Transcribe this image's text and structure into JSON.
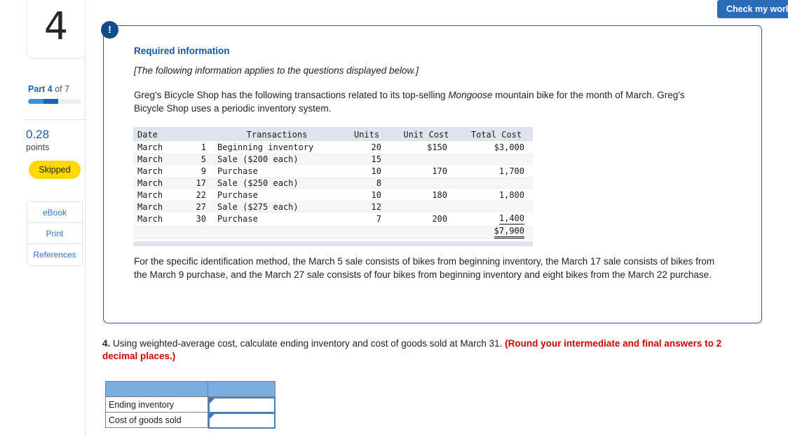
{
  "toolbar": {
    "check_my_work_label": "Check my work"
  },
  "sidebar": {
    "question_number": "4",
    "part_prefix": "Part 4",
    "part_suffix": " of 7",
    "progress_percent": 57,
    "points_value": "0.28",
    "points_label": "points",
    "status_badge": "Skipped",
    "buttons": [
      {
        "label": "eBook"
      },
      {
        "label": "Print"
      },
      {
        "label": "References"
      }
    ]
  },
  "info_card": {
    "alert_icon": "exclamation-icon",
    "alert_glyph": "!",
    "required_title": "Required information",
    "applies_note": "[The following information applies to the questions displayed below.]",
    "intro_part1": "Greg's Bicycle Shop has the following transactions related to its top-selling ",
    "intro_italic": "Mongoose",
    "intro_part2": " mountain bike for the month of March. Greg's Bicycle Shop uses a periodic inventory system.",
    "specific_id_para": "For the specific identification method, the March 5 sale consists of bikes from beginning inventory, the March 17 sale consists of bikes from the March 9 purchase, and the March 27 sale consists of four bikes from beginning inventory and eight bikes from the March 22 purchase."
  },
  "transactions_table": {
    "headers": [
      "Date",
      "Transactions",
      "Units",
      "Unit Cost",
      "Total Cost"
    ],
    "rows": [
      {
        "month": "March",
        "day": "1",
        "transaction": "Beginning inventory",
        "units": "20",
        "unit_cost": "$150",
        "total_cost": "$3,000",
        "shaded": false
      },
      {
        "month": "March",
        "day": "5",
        "transaction": "Sale ($200 each)",
        "units": "15",
        "unit_cost": "",
        "total_cost": "",
        "shaded": true
      },
      {
        "month": "March",
        "day": "9",
        "transaction": "Purchase",
        "units": "10",
        "unit_cost": "170",
        "total_cost": "1,700",
        "shaded": false
      },
      {
        "month": "March",
        "day": "17",
        "transaction": "Sale ($250 each)",
        "units": "8",
        "unit_cost": "",
        "total_cost": "",
        "shaded": true
      },
      {
        "month": "March",
        "day": "22",
        "transaction": "Purchase",
        "units": "10",
        "unit_cost": "180",
        "total_cost": "1,800",
        "shaded": false
      },
      {
        "month": "March",
        "day": "27",
        "transaction": "Sale ($275 each)",
        "units": "12",
        "unit_cost": "",
        "total_cost": "",
        "shaded": true
      },
      {
        "month": "March",
        "day": "30",
        "transaction": "Purchase",
        "units": "7",
        "unit_cost": "200",
        "total_cost": "1,400",
        "shaded": false
      }
    ],
    "total_row": {
      "total_cost": "$7,900"
    }
  },
  "question": {
    "number": "4.",
    "text": " Using weighted-average cost, calculate ending inventory and cost of goods sold at March 31. ",
    "rounding_note": "(Round your intermediate and final answers to 2 decimal places.)"
  },
  "answer_table": {
    "header_left": "",
    "header_right": "",
    "rows": [
      {
        "label": "Ending inventory",
        "value": ""
      },
      {
        "label": "Cost of goods sold",
        "value": ""
      }
    ]
  },
  "colors": {
    "accent_blue": "#2b6cb8",
    "card_border": "#1f5ba8",
    "alert_circle": "#134a8e",
    "badge_yellow": "#ffd900",
    "warning_red": "#cc0000",
    "table_header_bg": "#dfe3ec",
    "answer_header_bg": "#7aaee0",
    "input_border": "#4a7ebb"
  }
}
